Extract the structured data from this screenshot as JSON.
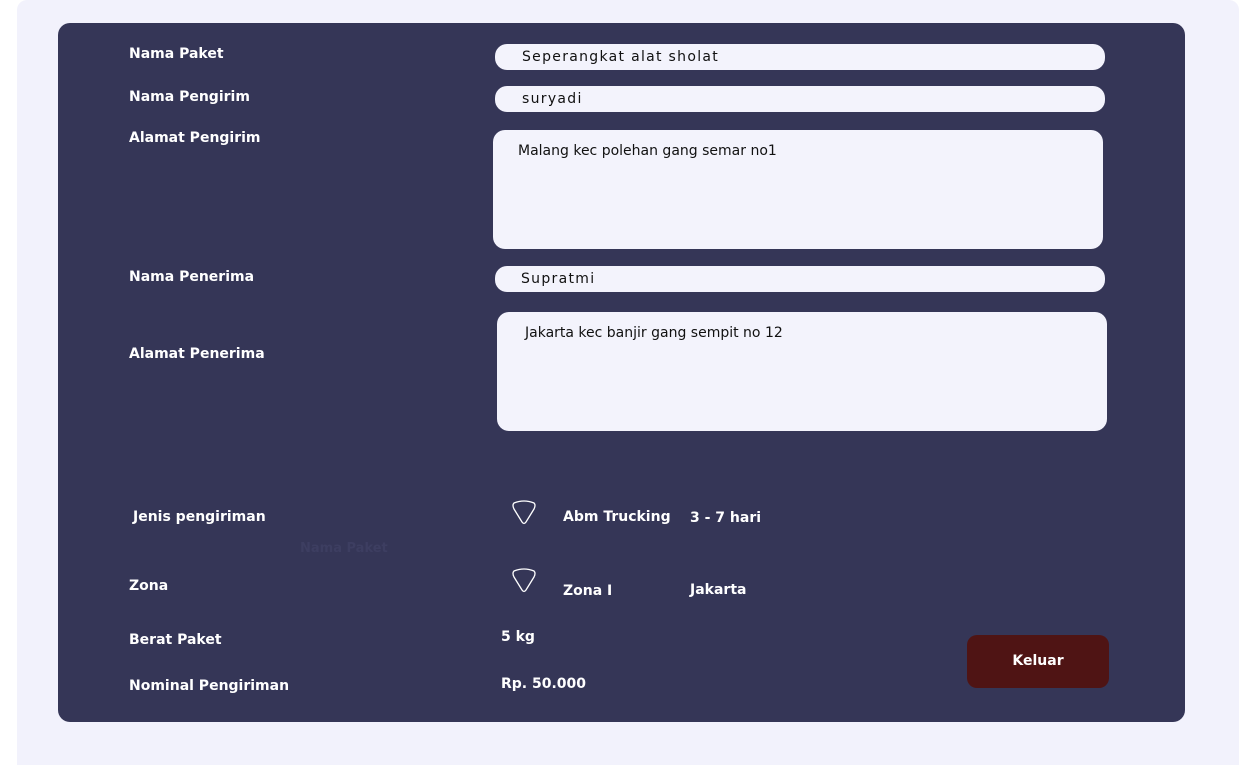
{
  "form": {
    "nama_paket": {
      "label": "Nama Paket",
      "value": "Seperangkat alat sholat"
    },
    "nama_pengirim": {
      "label": "Nama Pengirim",
      "value": "suryadi"
    },
    "alamat_pengirim": {
      "label": "Alamat Pengirim",
      "value": "Malang kec polehan gang semar no1"
    },
    "nama_penerima": {
      "label": "Nama Penerima",
      "value": "Supratmi"
    },
    "alamat_penerima": {
      "label": "Alamat Penerima",
      "value": "Jakarta kec banjir gang sempit no 12"
    },
    "jenis_pengiriman": {
      "label": "Jenis pengiriman",
      "option": "Abm Trucking",
      "detail": "3 - 7 hari"
    },
    "ghost_text": "Nama Paket",
    "zona": {
      "label": "Zona",
      "option": "Zona I",
      "detail": "Jakarta"
    },
    "berat_paket": {
      "label": "Berat Paket",
      "value": "5 kg"
    },
    "nominal_pengiriman": {
      "label": "Nominal Pengiriman",
      "value": "Rp. 50.000"
    }
  },
  "actions": {
    "keluar_label": "Keluar"
  },
  "colors": {
    "panel": "#353657",
    "background": "#f2f2fc",
    "button": "#4f1414"
  }
}
